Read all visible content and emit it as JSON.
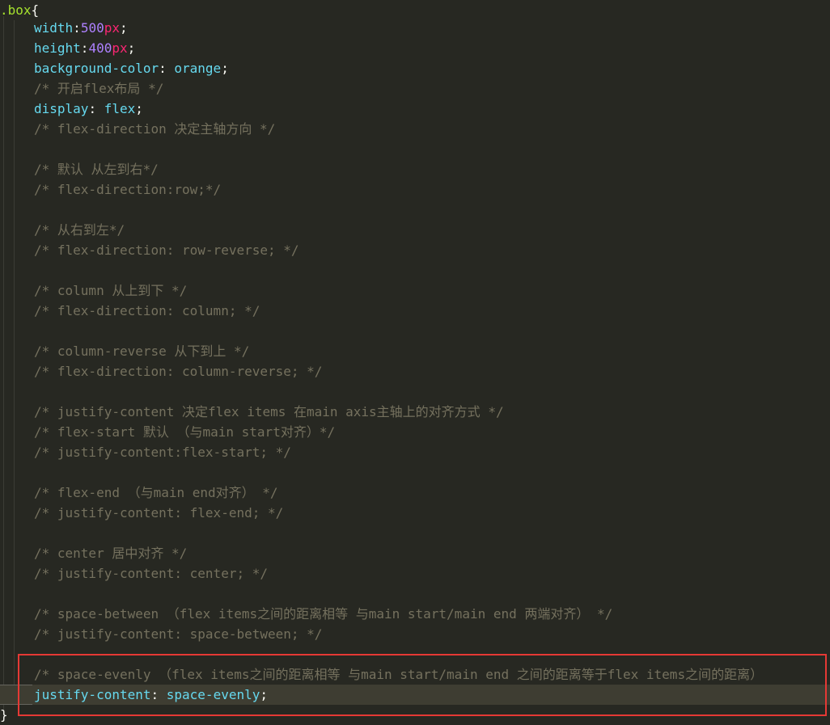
{
  "code": {
    "selector": ".box",
    "open_brace": "{",
    "close_brace": "}",
    "width_prop": "width",
    "width_num": "500",
    "width_unit": "px",
    "height_prop": "height",
    "height_num": "400",
    "height_unit": "px",
    "bg_prop": "background-color",
    "bg_val": "orange",
    "display_prop": "display",
    "display_val": "flex",
    "active_prop": "justify-content",
    "active_val": "space-evenly",
    "comments": [
      "/* 开启flex布局 */",
      "/* flex-direction 决定主轴方向 */",
      "/* 默认 从左到右*/",
      "/* flex-direction:row;*/",
      "/* 从右到左*/",
      "/* flex-direction: row-reverse; */",
      "/* column 从上到下 */",
      "/* flex-direction: column; */",
      "/* column-reverse 从下到上 */",
      "/* flex-direction: column-reverse; */",
      "/* justify-content 决定flex items 在main axis主轴上的对齐方式 */",
      "/* flex-start 默认 （与main start对齐）*/",
      "/* justify-content:flex-start; */",
      "/* flex-end （与main end对齐） */",
      "/* justify-content: flex-end; */",
      "/* center 居中对齐 */",
      "/* justify-content: center; */",
      "/* space-between （flex items之间的距离相等 与main start/main end 两端对齐） */",
      "/* justify-content: space-between; */",
      "/* space-evenly （flex items之间的距离相等 与main start/main end 之间的距离等于flex items之间的距离）"
    ]
  },
  "colors": {
    "background": "#272822",
    "selector": "#a6e22e",
    "property": "#66d9ef",
    "number": "#ae81ff",
    "unit": "#f92672",
    "comment": "#75715e",
    "highlight_border": "#e53935"
  }
}
